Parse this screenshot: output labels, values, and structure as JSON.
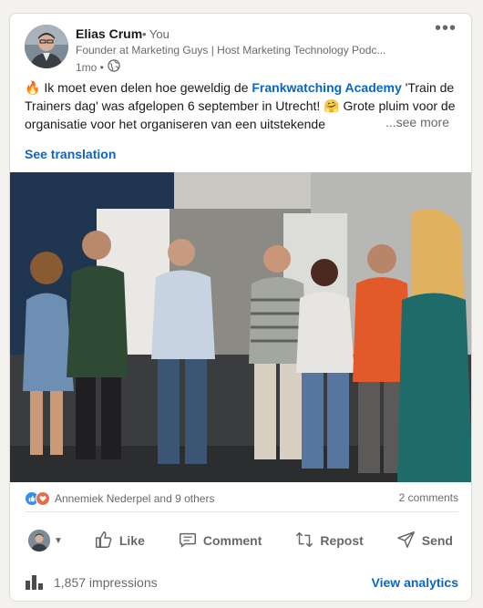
{
  "author": {
    "name": "Elias Crum",
    "relation": "• You",
    "headline": "Founder at Marketing Guys | Host Marketing Technology Podc...",
    "age": "1mo •",
    "visibility_icon": "globe-icon"
  },
  "post": {
    "text_prefix": "Ik moet even delen hoe geweldig de ",
    "text_link": "Frankwatching Academy",
    "text_mid": " 'Train de Trainers dag' was afgelopen 6 september in Utrecht! ",
    "text_suffix": " Grote pluim voor de organisatie voor het organiseren van een uitstekende",
    "emoji_fire": "🔥",
    "emoji_smile": "🤗",
    "see_more": "...see more",
    "see_translation": "See translation"
  },
  "social": {
    "reactions_text": "Annemiek Nederpel and 9 others",
    "comments": "2 comments",
    "reaction_colors": [
      "#378fe9",
      "#df704d"
    ]
  },
  "actions": {
    "like": "Like",
    "comment": "Comment",
    "repost": "Repost",
    "send": "Send"
  },
  "analytics": {
    "impressions": "1,857 impressions",
    "view_analytics": "View analytics"
  },
  "colors": {
    "link": "#0a66c2",
    "muted": "rgba(0,0,0,0.6)"
  }
}
